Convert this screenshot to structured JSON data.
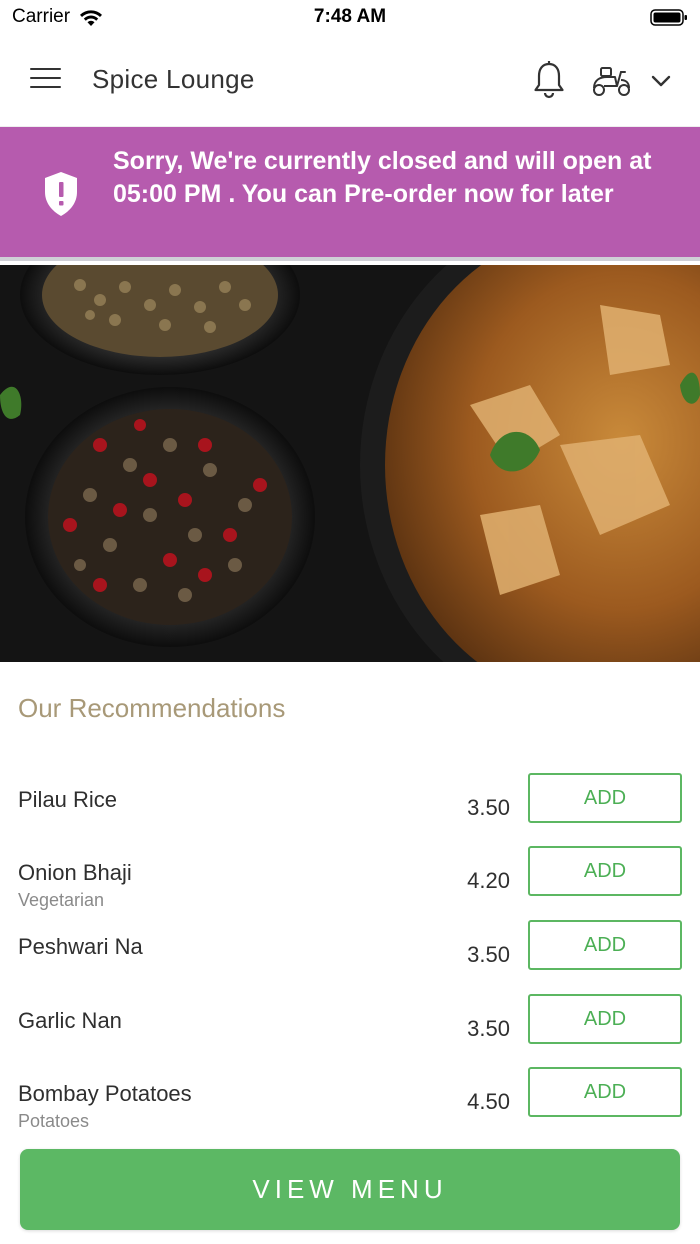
{
  "status_bar": {
    "carrier": "Carrier",
    "time": "7:48 AM"
  },
  "header": {
    "title": "Spice Lounge",
    "icons": [
      "menu-icon",
      "bell-icon",
      "scooter-icon",
      "chevron-down-icon"
    ]
  },
  "banner": {
    "message": "Sorry, We're currently closed and will open at 05:00 PM . You can Pre-order now for later",
    "color": "#b65bae",
    "icon": "shield-alert-icon"
  },
  "recommendations": {
    "heading": "Our Recommendations",
    "items": [
      {
        "name": "Pilau Rice",
        "subtitle": "",
        "price": "3.50",
        "button": "ADD"
      },
      {
        "name": "Onion Bhaji",
        "subtitle": "Vegetarian",
        "price": "4.20",
        "button": "ADD"
      },
      {
        "name": "Peshwari Na",
        "subtitle": "",
        "price": "3.50",
        "button": "ADD"
      },
      {
        "name": "Garlic Nan",
        "subtitle": "",
        "price": "3.50",
        "button": "ADD"
      },
      {
        "name": "Bombay Potatoes",
        "subtitle": "Potatoes",
        "price": "4.50",
        "button": "ADD"
      }
    ]
  },
  "footer": {
    "view_menu_label": "VIEW MENU",
    "accent_color": "#5cb864"
  }
}
